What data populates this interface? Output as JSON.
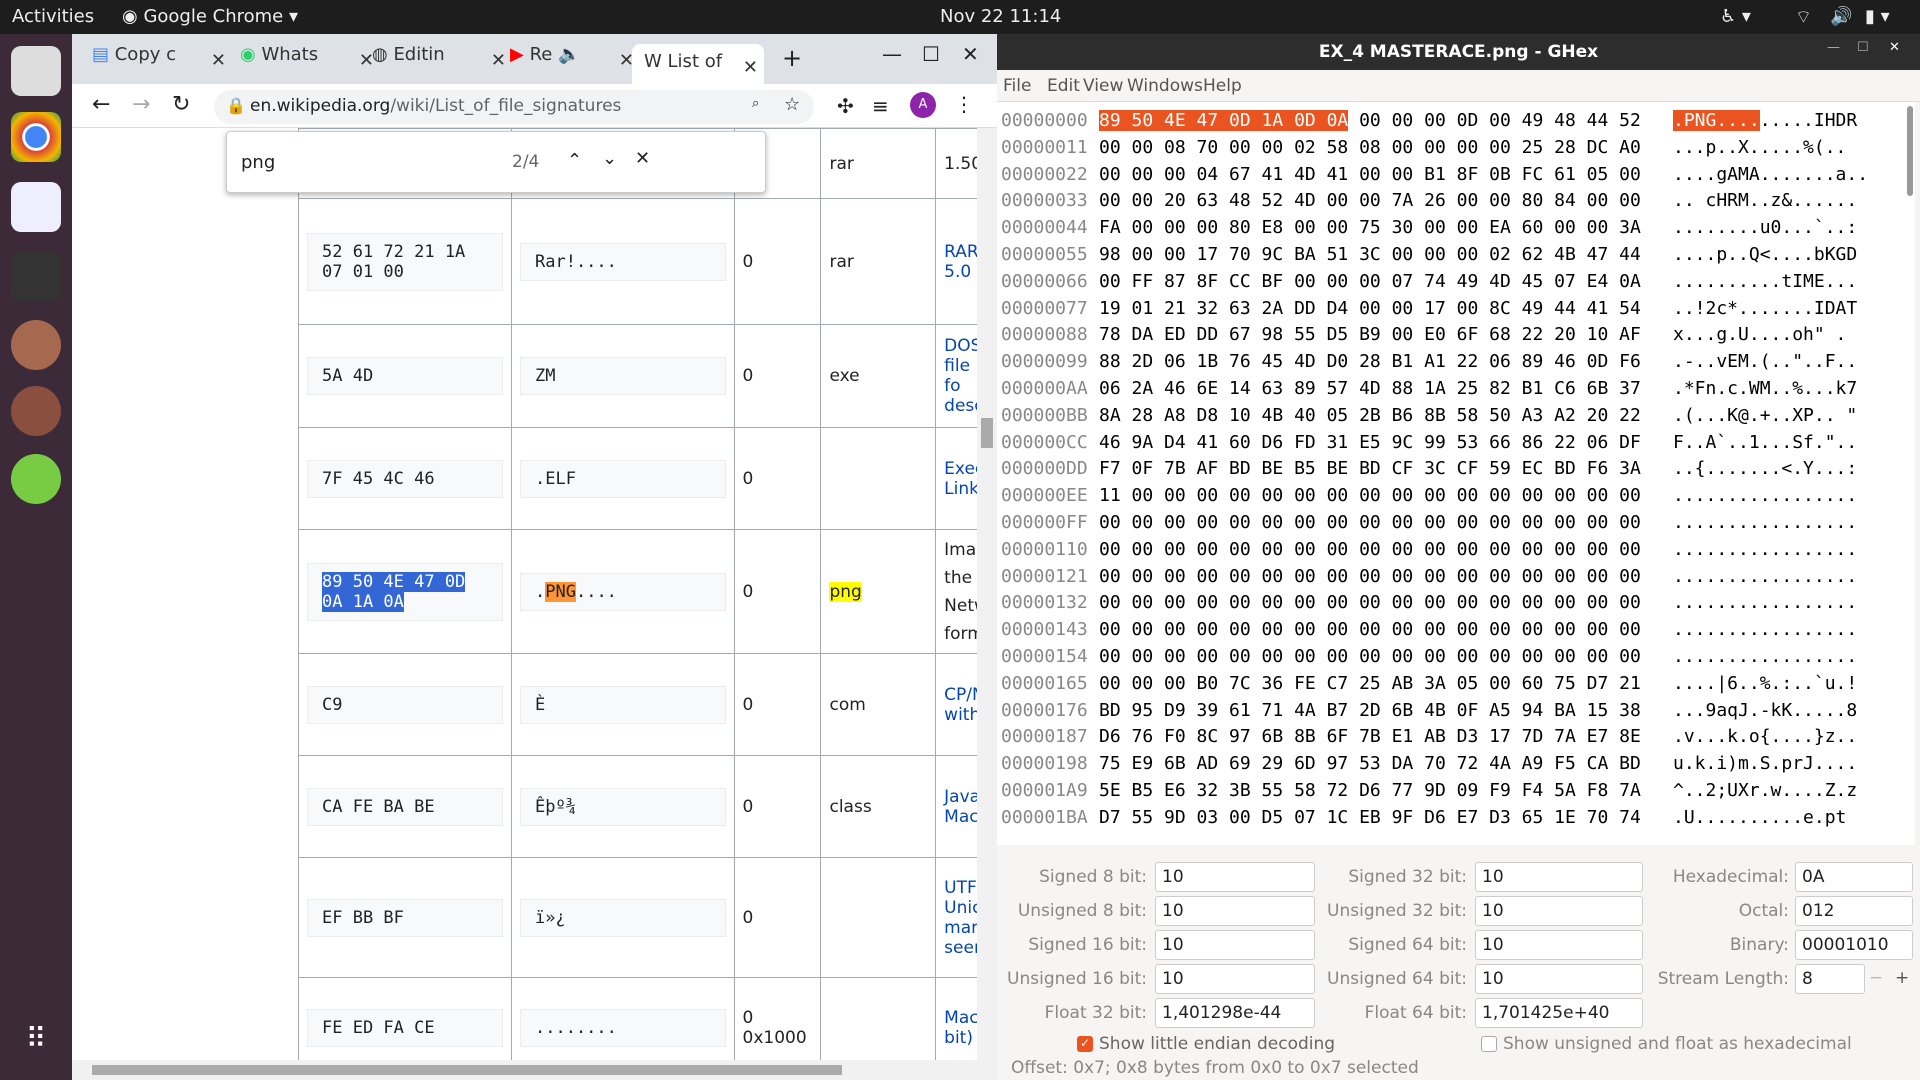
{
  "topbar": {
    "activities": "Activities",
    "app": "Google Chrome",
    "datetime": "Nov 22  11:14"
  },
  "chrome": {
    "tabs": [
      {
        "label": "Copy c"
      },
      {
        "label": "Whats"
      },
      {
        "label": "Editin"
      },
      {
        "label": "Re"
      },
      {
        "label": "List of"
      }
    ],
    "url_host": "en.wikipedia.org",
    "url_path": "/wiki/List_of_file_signatures",
    "avatar": "A",
    "find": {
      "query": "png",
      "count": "2/4"
    },
    "rows": [
      {
        "hex": "",
        "ascii": "",
        "offset": "",
        "ext": "rar",
        "desc": "1.50"
      },
      {
        "hex": "52 61 72 21 1A 07 01 00",
        "ascii": "Rar!....",
        "offset": "0",
        "ext": "rar",
        "desc": "RAR 5.0 c"
      },
      {
        "hex": "5A 4D",
        "ascii": "ZM",
        "offset": "0",
        "ext": "exe",
        "desc": "DOS file fo desc"
      },
      {
        "hex": "7F 45 4C 46",
        "ascii": ".ELF",
        "offset": "0",
        "ext": "",
        "desc": "Exec Link"
      },
      {
        "hex_a": "89 50 4E 47 0D",
        "hex_b": "0A 1A 0A",
        "ascii_pre": ".",
        "ascii_hl": "PNG",
        "ascii_post": "....",
        "offset": "0",
        "ext": "png",
        "desc": "Imag the P Netw form"
      },
      {
        "hex": "C9",
        "ascii": "È",
        "offset": "0",
        "ext": "com",
        "desc": "CP/M with"
      },
      {
        "hex": "CA FE BA BE",
        "ascii": "Êþº¾",
        "offset": "0",
        "ext": "class",
        "desc": "Java Mac"
      },
      {
        "hex": "EF BB BF",
        "ascii": "ï»¿",
        "offset": "0",
        "ext": "",
        "desc": "UTF Unic mark seen"
      },
      {
        "hex": "FE ED FA CE",
        "ascii": "........",
        "offset": "0 0x1000",
        "ext": "",
        "desc": "Mac bit)"
      }
    ]
  },
  "ghex": {
    "title": "EX_4 MASTERACE.png - GHex",
    "menu": [
      "File",
      "Edit",
      "View",
      "Windows",
      "Help"
    ],
    "rows": [
      {
        "off": "00000000",
        "sel_hex": "89 50 4E 47 0D 1A 0D 0A",
        "hex": " 00 00 00 0D 00 49 48 44 52",
        "sel_asc": ".PNG....",
        "asc": ".....IHDR"
      },
      {
        "off": "00000011",
        "hex": "00 00 08 70 00 00 02 58 08 00 00 00 00 25 28 DC A0",
        "asc": "...p..X.....%(.."
      },
      {
        "off": "00000022",
        "hex": "00 00 00 04 67 41 4D 41 00 00 B1 8F 0B FC 61 05 00",
        "asc": "....gAMA.......a.."
      },
      {
        "off": "00000033",
        "hex": "00 00 20 63 48 52 4D 00 00 7A 26 00 00 80 84 00 00",
        "asc": ".. cHRM..z&......"
      },
      {
        "off": "00000044",
        "hex": "FA 00 00 00 80 E8 00 00 75 30 00 00 EA 60 00 00 3A",
        "asc": "........u0...`..:"
      },
      {
        "off": "00000055",
        "hex": "98 00 00 17 70 9C BA 51 3C 00 00 00 02 62 4B 47 44",
        "asc": "....p..Q<....bKGD"
      },
      {
        "off": "00000066",
        "hex": "00 FF 87 8F CC BF 00 00 00 07 74 49 4D 45 07 E4 0A",
        "asc": "..........tIME..."
      },
      {
        "off": "00000077",
        "hex": "19 01 21 32 63 2A DD D4 00 00 17 00 8C 49 44 41 54",
        "asc": "..!2c*.......IDAT"
      },
      {
        "off": "00000088",
        "hex": "78 DA ED DD 67 98 55 D5 B9 00 E0 6F 68 22 20 10 AF",
        "asc": "x...g.U....oh\" ."
      },
      {
        "off": "00000099",
        "hex": "88 2D 06 1B 76 45 4D D0 28 B1 A1 22 06 89 46 0D F6",
        "asc": ".-..vEM.(..\"..F.."
      },
      {
        "off": "000000AA",
        "hex": "06 2A 46 6E 14 63 89 57 4D 88 1A 25 82 B1 C6 6B 37",
        "asc": ".*Fn.c.WM..%...k7"
      },
      {
        "off": "000000BB",
        "hex": "8A 28 A8 D8 10 4B 40 05 2B B6 8B 58 50 A3 A2 20 22",
        "asc": ".(...K@.+..XP.. \""
      },
      {
        "off": "000000CC",
        "hex": "46 9A D4 41 60 D6 FD 31 E5 9C 99 53 66 86 22 06 DF",
        "asc": "F..A`..1...Sf.\".."
      },
      {
        "off": "000000DD",
        "hex": "F7 0F 7B AF BD BE B5 BE BD CF 3C CF 59 EC BD F6 3A",
        "asc": "..{.......<.Y...:"
      },
      {
        "off": "000000EE",
        "hex": "11 00 00 00 00 00 00 00 00 00 00 00 00 00 00 00 00",
        "asc": "................."
      },
      {
        "off": "000000FF",
        "hex": "00 00 00 00 00 00 00 00 00 00 00 00 00 00 00 00 00",
        "asc": "................."
      },
      {
        "off": "00000110",
        "hex": "00 00 00 00 00 00 00 00 00 00 00 00 00 00 00 00 00",
        "asc": "................."
      },
      {
        "off": "00000121",
        "hex": "00 00 00 00 00 00 00 00 00 00 00 00 00 00 00 00 00",
        "asc": "................."
      },
      {
        "off": "00000132",
        "hex": "00 00 00 00 00 00 00 00 00 00 00 00 00 00 00 00 00",
        "asc": "................."
      },
      {
        "off": "00000143",
        "hex": "00 00 00 00 00 00 00 00 00 00 00 00 00 00 00 00 00",
        "asc": "................."
      },
      {
        "off": "00000154",
        "hex": "00 00 00 00 00 00 00 00 00 00 00 00 00 00 00 00 00",
        "asc": "................."
      },
      {
        "off": "00000165",
        "hex": "00 00 00 B0 7C 36 FE C7 25 AB 3A 05 00 60 75 D7 21",
        "asc": "....|6..%.:..`u.!"
      },
      {
        "off": "00000176",
        "hex": "BD 95 D9 39 61 71 4A B7 2D 6B 4B 0F A5 94 BA 15 38",
        "asc": "...9aqJ.-kK.....8"
      },
      {
        "off": "00000187",
        "hex": "D6 76 F0 8C 97 6B 8B 6F 7B E1 AB D3 17 7D 7A E7 8E",
        "asc": ".v...k.o{....}z.."
      },
      {
        "off": "00000198",
        "hex": "75 E9 6B AD 69 29 6D 97 53 DA 70 72 4A A9 F5 CA BD",
        "asc": "u.k.i)m.S.prJ...."
      },
      {
        "off": "000001A9",
        "hex": "5E B5 E6 32 3B 55 58 72 D6 77 9D 09 F9 F4 5A F8 7A",
        "asc": "^..2;UXr.w....Z.z"
      },
      {
        "off": "000001BA",
        "hex": "D7 55 9D 03 00 D5 07 1C EB 9F D6 E7 D3 65 1E 70 74",
        "asc": ".U..........e.pt"
      }
    ],
    "conv": {
      "s8_label": "Signed 8 bit:",
      "s8": "10",
      "u8_label": "Unsigned 8 bit:",
      "u8": "10",
      "s16_label": "Signed 16 bit:",
      "s16": "10",
      "u16_label": "Unsigned 16 bit:",
      "u16": "10",
      "f32_label": "Float 32 bit:",
      "f32": "1,401298e-44",
      "s32_label": "Signed 32 bit:",
      "s32": "10",
      "u32_label": "Unsigned 32 bit:",
      "u32": "10",
      "s64_label": "Signed 64 bit:",
      "s64": "10",
      "u64_label": "Unsigned 64 bit:",
      "u64": "10",
      "f64_label": "Float 64 bit:",
      "f64": "1,701425e+40",
      "hex_label": "Hexadecimal:",
      "hexv": "0A",
      "oct_label": "Octal:",
      "octv": "012",
      "bin_label": "Binary:",
      "binv": "00001010",
      "stream_label": "Stream Length:",
      "stream": "8",
      "little_endian": "Show little endian decoding",
      "unsigned_hex": "Show unsigned and float as hexadecimal"
    },
    "status": "Offset: 0x7; 0x8 bytes from 0x0 to 0x7 selected"
  }
}
